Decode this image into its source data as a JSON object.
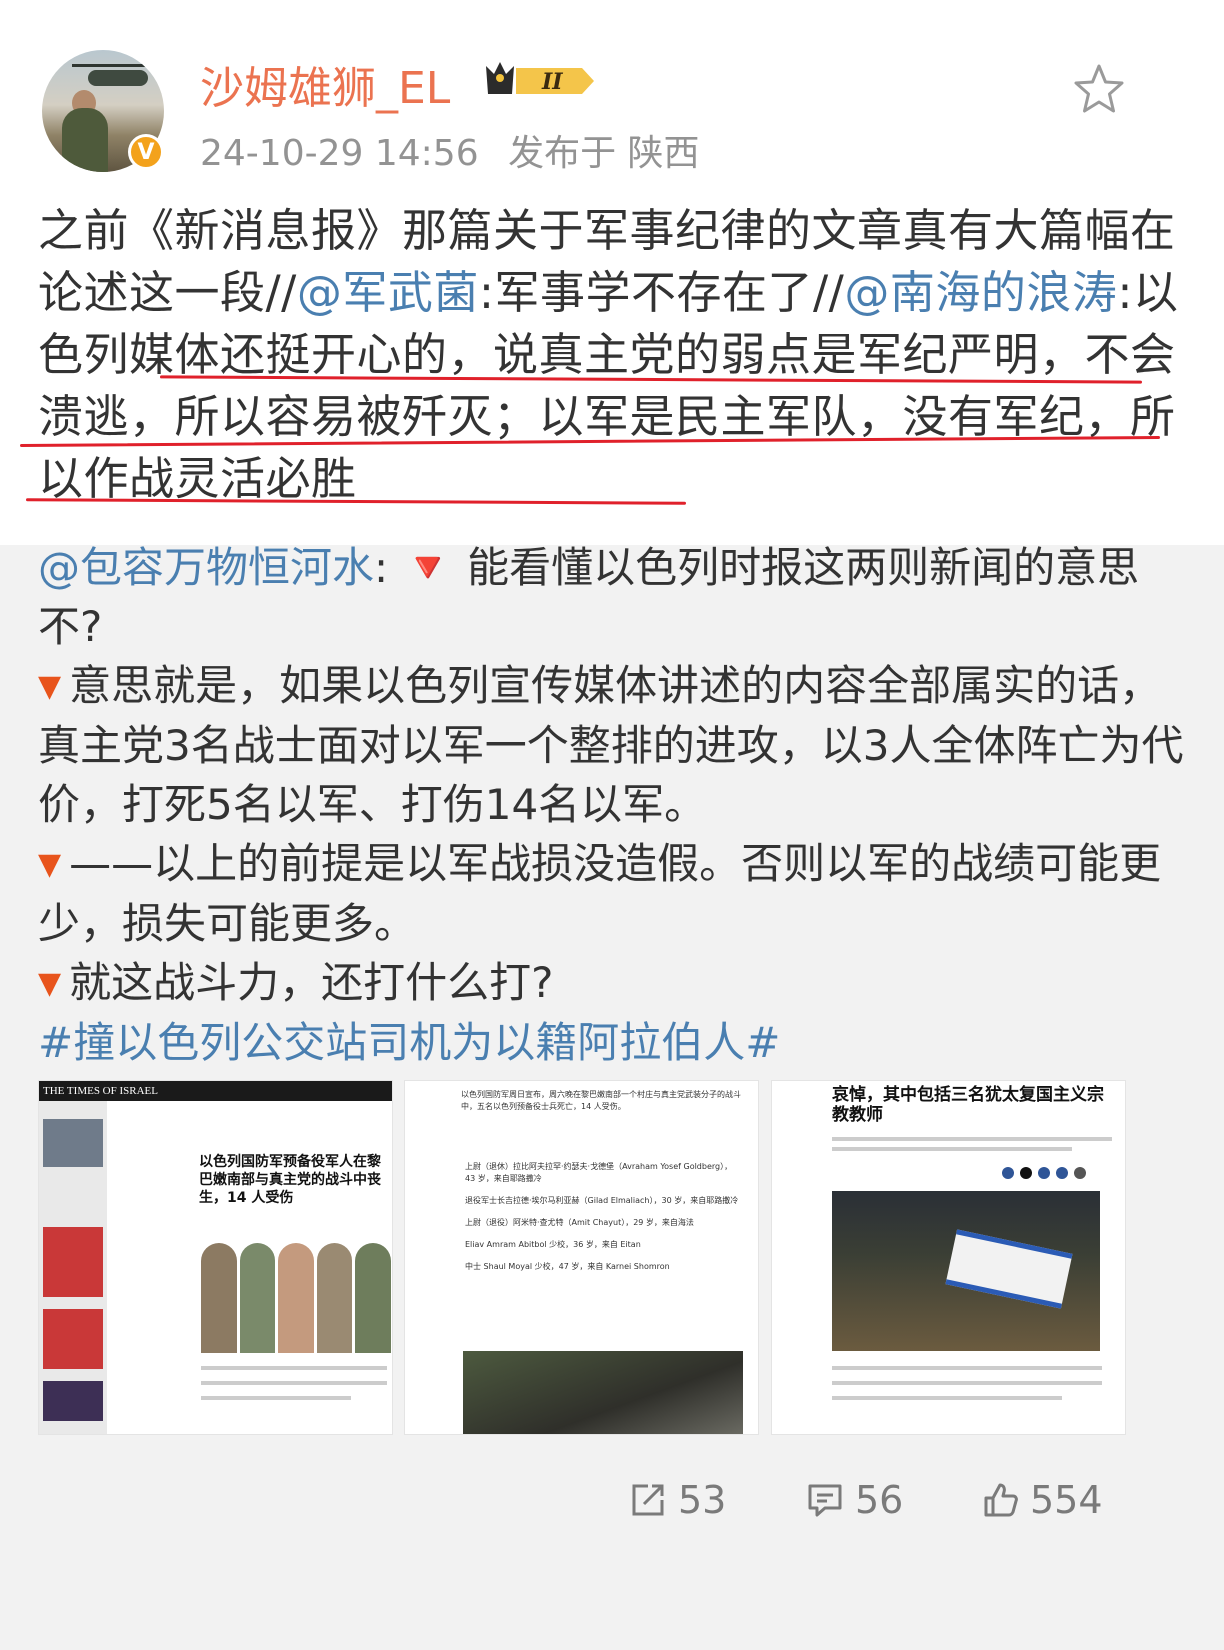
{
  "post": {
    "author": "沙姆雄狮_EL",
    "rank_badge": "II",
    "time": "24-10-29 14:56",
    "location": "发布于 陕西",
    "text_parts": {
      "p1": "之前《新消息报》那篇关于军事纪律的文章真有大篇幅在论述这一段//",
      "m1": "@军武菌",
      "p2": ":军事学不存在了//",
      "m2": "@南海的浪涛",
      "p3": ":以色列媒体还挺开心的，说真主党的弱点是军纪严明，不会溃逃，所以容易被歼灭；以军是民主军队，没有军纪，所以作战灵活必胜"
    }
  },
  "repost": {
    "mention": "@包容万物恒河水",
    "l1": ": 🔻 能看懂以色列时报这两则新闻的意思不?",
    "l2": "意思就是，如果以色列宣传媒体讲述的内容全部属实的话，真主党3名战士面对以军一个整排的进攻，以3人全体阵亡为代价，打死5名以军、打伤14名以军。",
    "l3": "——以上的前提是以军战损没造假。否则以军的战绩可能更少，损失可能更多。",
    "l4": "就这战斗力，还打什么打?",
    "hashtag": "#撞以色列公交站司机为以籍阿拉伯人#"
  },
  "images": {
    "img1": {
      "masthead": "THE TIMES OF ISRAEL",
      "headline": "以色列国防军预备役军人在黎巴嫩南部与真主党的战斗中丧生，14 人受伤"
    },
    "img2": {
      "intro": "以色列国防军周日宣布，周六晚在黎巴嫩南部一个村庄与真主党武装分子的战斗中，五名以色列预备役士兵死亡，14 人受伤。",
      "items": [
        "上尉（退休）拉比阿夫拉罕·约瑟夫·戈德堡（Avraham Yosef Goldberg），43 岁，来自耶路撒冷",
        "退役军士长吉拉德·埃尔马利亚赫（Gilad Elmaliach），30 岁，来自耶路撒冷",
        "上尉（退役）阿米特·查尤特（Amit Chayut），29 岁，来自海法",
        "Eliav Amram Abitbol 少校，36 岁，来自 Eitan",
        "中士 Shaul Moyal 少校，47 岁，来自 Karnei Shomron"
      ]
    },
    "img3": {
      "headline": "哀悼，其中包括三名犹太复国主义宗教教师"
    }
  },
  "actions": {
    "repost_count": "53",
    "comment_count": "56",
    "like_count": "554"
  },
  "colors": {
    "username": "#eb7350",
    "mention": "#4a7fb0",
    "underline": "#e0212b",
    "triangle": "#e8541c",
    "badge": "#f3a21c"
  }
}
